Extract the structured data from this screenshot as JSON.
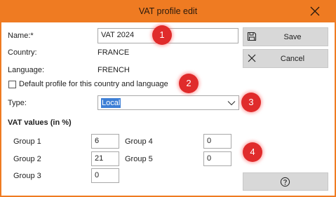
{
  "window": {
    "title": "VAT profile edit"
  },
  "form": {
    "name_label": "Name:*",
    "name_value": "VAT 2024",
    "country_label": "Country:",
    "country_value": "FRANCE",
    "language_label": "Language:",
    "language_value": "FRENCH",
    "default_checkbox_label": "Default profile for this country and language",
    "default_checked": false,
    "type_label": "Type:",
    "type_value": "Local",
    "vat_section_title": "VAT values (in %)",
    "groups": [
      {
        "label": "Group 1",
        "value": "6"
      },
      {
        "label": "Group 2",
        "value": "21"
      },
      {
        "label": "Group 3",
        "value": "0"
      },
      {
        "label": "Group 4",
        "value": "0"
      },
      {
        "label": "Group 5",
        "value": "0"
      }
    ]
  },
  "buttons": {
    "save_label": "Save",
    "cancel_label": "Cancel",
    "help_icon": "question-circle-icon"
  },
  "badges": [
    "1",
    "2",
    "3",
    "4"
  ],
  "colors": {
    "accent": "#ef7b22",
    "badge": "#e02b2b",
    "selection": "#3d7fd6",
    "button_bg": "#d8d8d8"
  }
}
